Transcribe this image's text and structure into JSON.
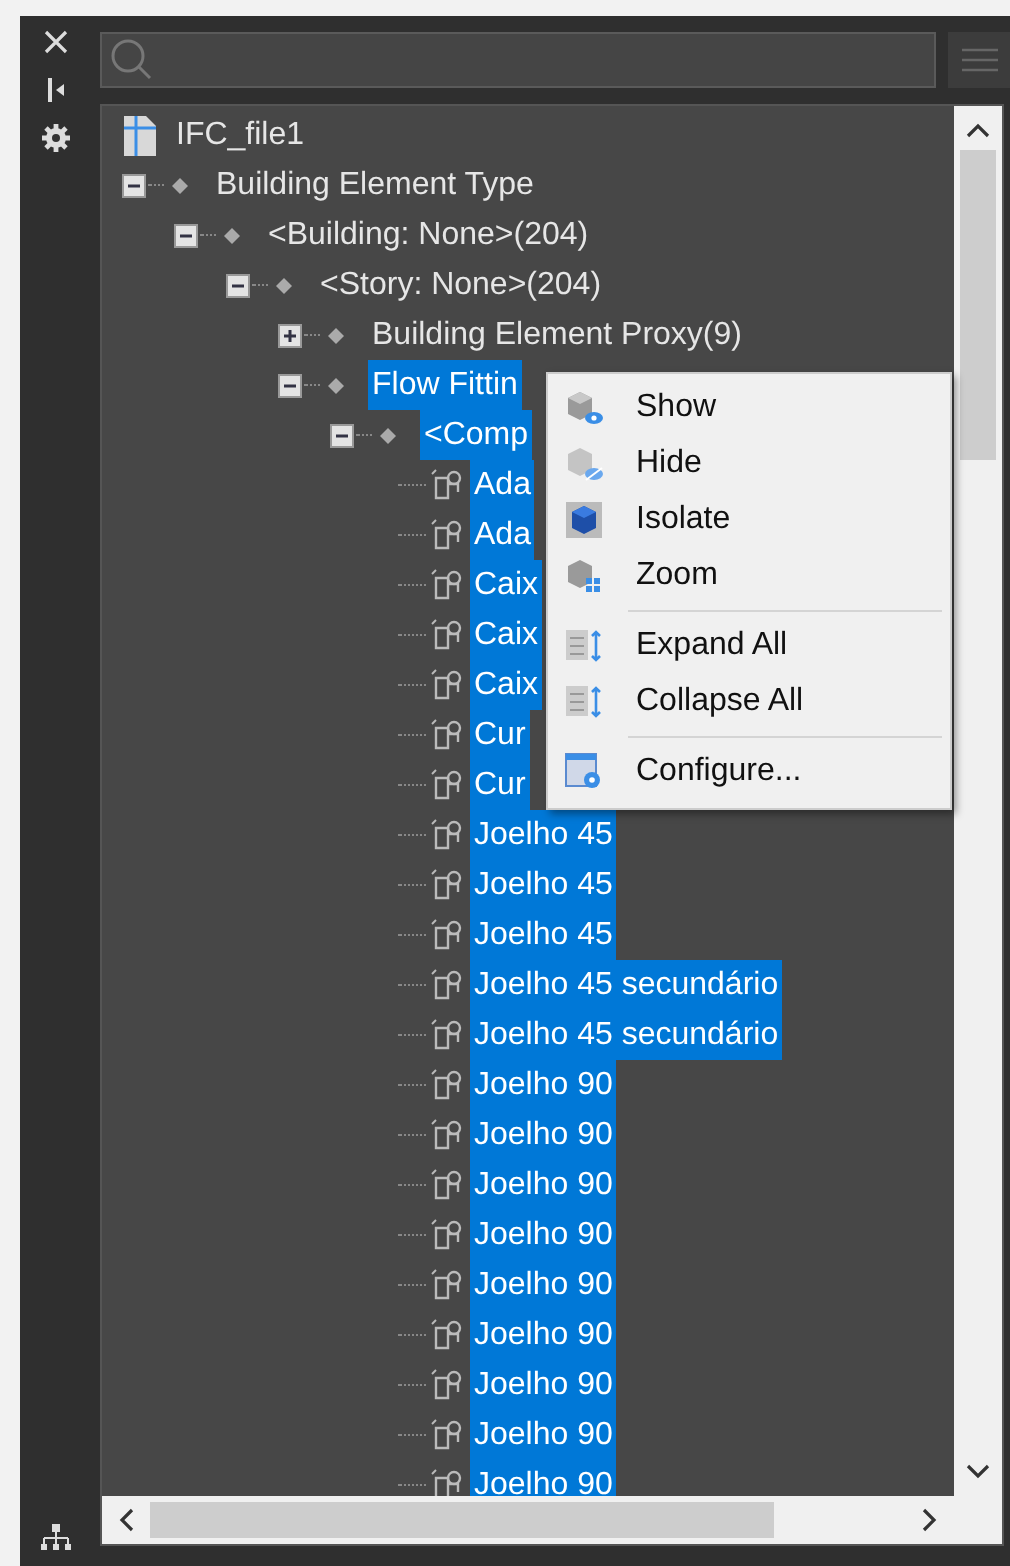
{
  "tree": {
    "label": "IFC_file1",
    "kind": "root",
    "selected": false,
    "children": [
      {
        "label": "Building Element Type",
        "kind": "group",
        "expanded": true,
        "selected": false,
        "children": [
          {
            "label": "<Building: None>(204)",
            "kind": "group",
            "expanded": true,
            "selected": false,
            "children": [
              {
                "label": "<Story: None>(204)",
                "kind": "group",
                "expanded": true,
                "selected": false,
                "children": [
                  {
                    "label": "Building Element Proxy(9)",
                    "kind": "group",
                    "expanded": false,
                    "selected": false
                  },
                  {
                    "label": "Flow Fittin",
                    "kind": "group",
                    "expanded": true,
                    "selected": true,
                    "children": [
                      {
                        "label": "<Comp",
                        "kind": "group",
                        "expanded": true,
                        "selected": true,
                        "children": [
                          {
                            "label": "Ada",
                            "kind": "element",
                            "selected": true
                          },
                          {
                            "label": "Ada",
                            "kind": "element",
                            "selected": true
                          },
                          {
                            "label": "Caix",
                            "kind": "element",
                            "selected": true
                          },
                          {
                            "label": "Caix",
                            "kind": "element",
                            "selected": true
                          },
                          {
                            "label": "Caix",
                            "kind": "element",
                            "selected": true
                          },
                          {
                            "label": "Cur",
                            "kind": "element",
                            "selected": true
                          },
                          {
                            "label": "Cur",
                            "kind": "element",
                            "selected": true
                          },
                          {
                            "label": "Joelho 45",
                            "kind": "element",
                            "selected": true
                          },
                          {
                            "label": "Joelho 45",
                            "kind": "element",
                            "selected": true
                          },
                          {
                            "label": "Joelho 45",
                            "kind": "element",
                            "selected": true
                          },
                          {
                            "label": "Joelho 45 secundário",
                            "kind": "element",
                            "selected": true
                          },
                          {
                            "label": "Joelho 45 secundário",
                            "kind": "element",
                            "selected": true
                          },
                          {
                            "label": "Joelho 90",
                            "kind": "element",
                            "selected": true
                          },
                          {
                            "label": "Joelho 90",
                            "kind": "element",
                            "selected": true
                          },
                          {
                            "label": "Joelho 90",
                            "kind": "element",
                            "selected": true
                          },
                          {
                            "label": "Joelho 90",
                            "kind": "element",
                            "selected": true
                          },
                          {
                            "label": "Joelho 90",
                            "kind": "element",
                            "selected": true
                          },
                          {
                            "label": "Joelho 90",
                            "kind": "element",
                            "selected": true
                          },
                          {
                            "label": "Joelho 90",
                            "kind": "element",
                            "selected": true
                          },
                          {
                            "label": "Joelho 90",
                            "kind": "element",
                            "selected": true
                          },
                          {
                            "label": "Joelho 90",
                            "kind": "element",
                            "selected": true
                          }
                        ]
                      }
                    ]
                  }
                ]
              }
            ]
          }
        ]
      }
    ]
  },
  "context_menu": {
    "groups": [
      {
        "items": [
          {
            "label": "Show"
          },
          {
            "label": "Hide"
          },
          {
            "label": "Isolate"
          },
          {
            "label": "Zoom"
          }
        ]
      },
      {
        "items": [
          {
            "label": "Expand All"
          },
          {
            "label": "Collapse All"
          }
        ]
      },
      {
        "items": [
          {
            "label": "Configure..."
          }
        ]
      }
    ]
  }
}
